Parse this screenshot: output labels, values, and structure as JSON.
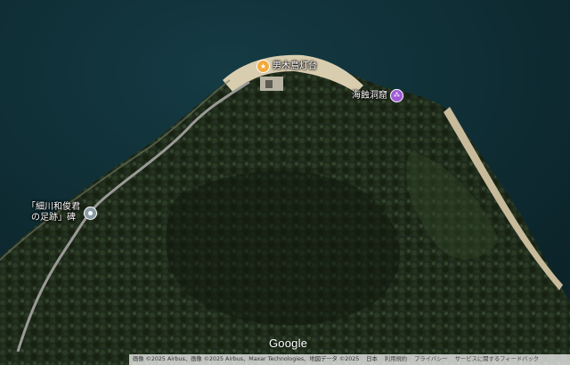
{
  "markers": {
    "lighthouse": {
      "label": "男木島灯台",
      "icon": "star-icon",
      "color": "#f2a93b"
    },
    "cave": {
      "label": "海蝕洞窟",
      "icon": "cave-icon",
      "color": "#a05ad8"
    },
    "monument": {
      "label_line1": "「細川和俊君",
      "label_line2": "の足跡」碑",
      "icon": "monument-icon",
      "color": "#8a9ba3"
    }
  },
  "branding": {
    "logo": "Google"
  },
  "footer": {
    "attribution": "画像 ©2025 Airbus、画像 ©2025 Airbus、Maxar Technologies、地図データ ©2025",
    "country": "日本",
    "terms": "利用規約",
    "privacy": "プライバシー",
    "feedback": "サービスに関するフィードバック"
  },
  "colors": {
    "sea": "#0f2d35",
    "forest": "#1f2a1a",
    "beach": "#d9cdb0",
    "road": "#9a9a96"
  }
}
